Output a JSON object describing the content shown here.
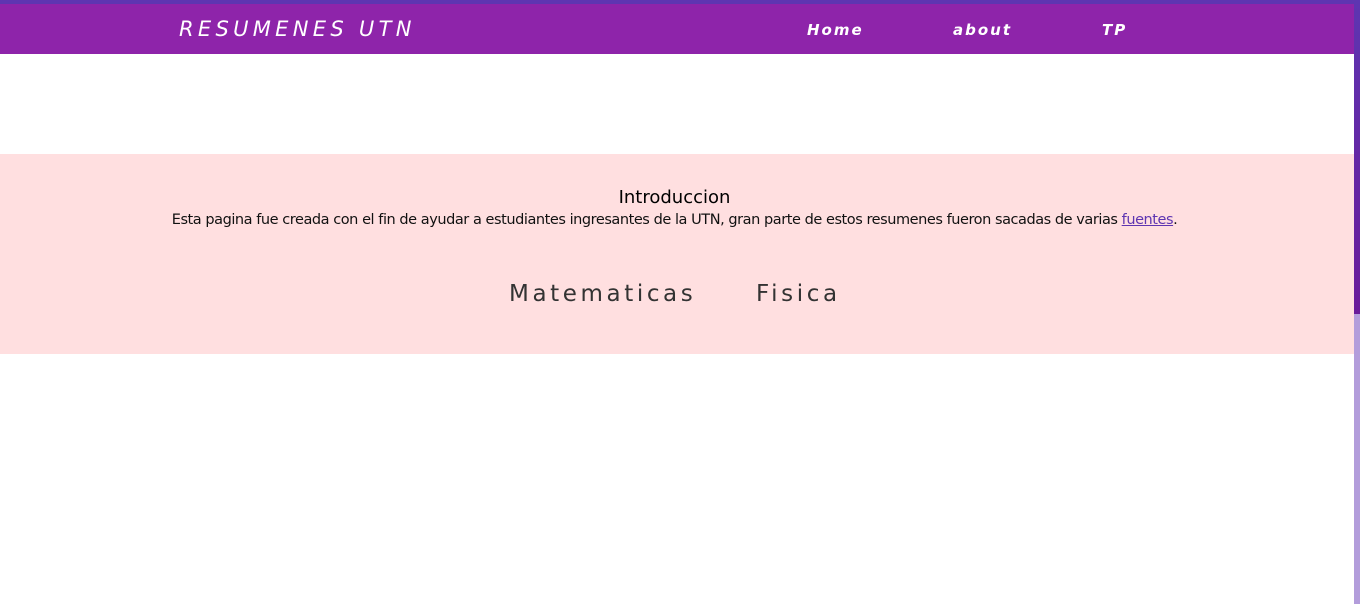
{
  "colors": {
    "navbar": "#8e24aa",
    "top_strip": "#5e35b1",
    "intro_background": "#ffdfe0",
    "link": "#5e35b1",
    "scrollbar": "#6a1b9a"
  },
  "header": {
    "brand": "RESUMENES UTN",
    "nav": {
      "home": "Home",
      "about": "about",
      "tp": "TP"
    }
  },
  "intro": {
    "title": "Introduccion",
    "text_before_link": "Esta pagina fue creada con el fin de ayudar a estudiantes ingresantes de la UTN, gran parte de estos resumenes fueron sacadas de varias ",
    "link_text": "fuentes",
    "text_after_link": "."
  },
  "subjects": {
    "matematicas": "Matematicas",
    "fisica": "Fisica"
  }
}
